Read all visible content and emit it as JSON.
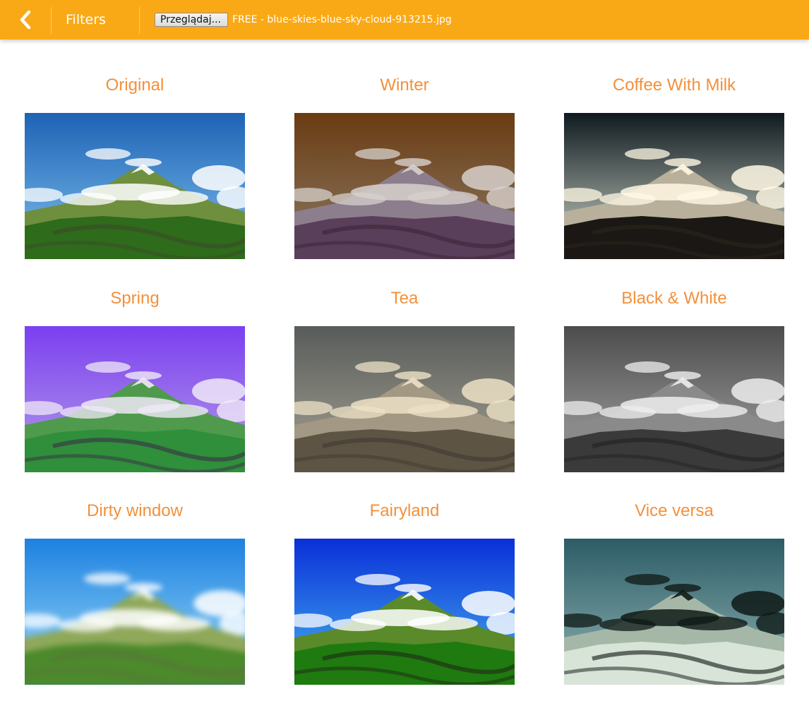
{
  "header": {
    "back_icon": "chevron-left-icon",
    "title": "Filters",
    "file_button_label": "Przeglądaj...",
    "file_name": "FREE - blue-skies-blue-sky-cloud-913215.jpg",
    "accent_color": "#faa916"
  },
  "filters": [
    {
      "label": "Original",
      "sky_top": "#1e63b5",
      "sky_bottom": "#7fc0ee",
      "cloud": "#ffffff",
      "mountain": "#6e8f3e",
      "foreground": "#2e6b1a",
      "shade": "#3c4a2a"
    },
    {
      "label": "Winter",
      "sky_top": "#6a3c12",
      "sky_bottom": "#8c7a66",
      "cloud": "#d7d0cc",
      "mountain": "#8c7e8c",
      "foreground": "#5a3f5a",
      "shade": "#3a2438"
    },
    {
      "label": "Coffee With Milk",
      "sky_top": "#0f1a20",
      "sky_bottom": "#cfd6c8",
      "cloud": "#fff8e4",
      "mountain": "#b8b09a",
      "foreground": "#1a1714",
      "shade": "#2c261c"
    },
    {
      "label": "Spring",
      "sky_top": "#7b3ff0",
      "sky_bottom": "#b59ee8",
      "cloud": "#efe8f7",
      "mountain": "#4f9a4c",
      "foreground": "#2f8f3a",
      "shade": "#3c2f48"
    },
    {
      "label": "Tea",
      "sky_top": "#585c5a",
      "sky_bottom": "#a6a394",
      "cloud": "#ece1c6",
      "mountain": "#a29883",
      "foreground": "#5d5444",
      "shade": "#403a30"
    },
    {
      "label": "Black & White",
      "sky_top": "#4c4c4c",
      "sky_bottom": "#a8a8a8",
      "cloud": "#ededed",
      "mountain": "#8a8a8a",
      "foreground": "#3a3a3a",
      "shade": "#222222"
    },
    {
      "label": "Dirty window",
      "sky_top": "#1b80e0",
      "sky_bottom": "#9fdcf8",
      "cloud": "#ffffff",
      "mountain": "#8fa85a",
      "foreground": "#4c8a2c",
      "shade": "#5e6a3c",
      "blurred": true
    },
    {
      "label": "Fairyland",
      "sky_top": "#0a2fd8",
      "sky_bottom": "#47b5f0",
      "cloud": "#ffffff",
      "mountain": "#5a8a2a",
      "foreground": "#1f7a10",
      "shade": "#1f2a14"
    },
    {
      "label": "Vice versa",
      "sky_top": "#2d5c66",
      "sky_bottom": "#8fb4b4",
      "cloud": "#0f1a16",
      "mountain": "#a5b8a8",
      "foreground": "#d8e4d8",
      "shade": "#0c1410"
    }
  ]
}
